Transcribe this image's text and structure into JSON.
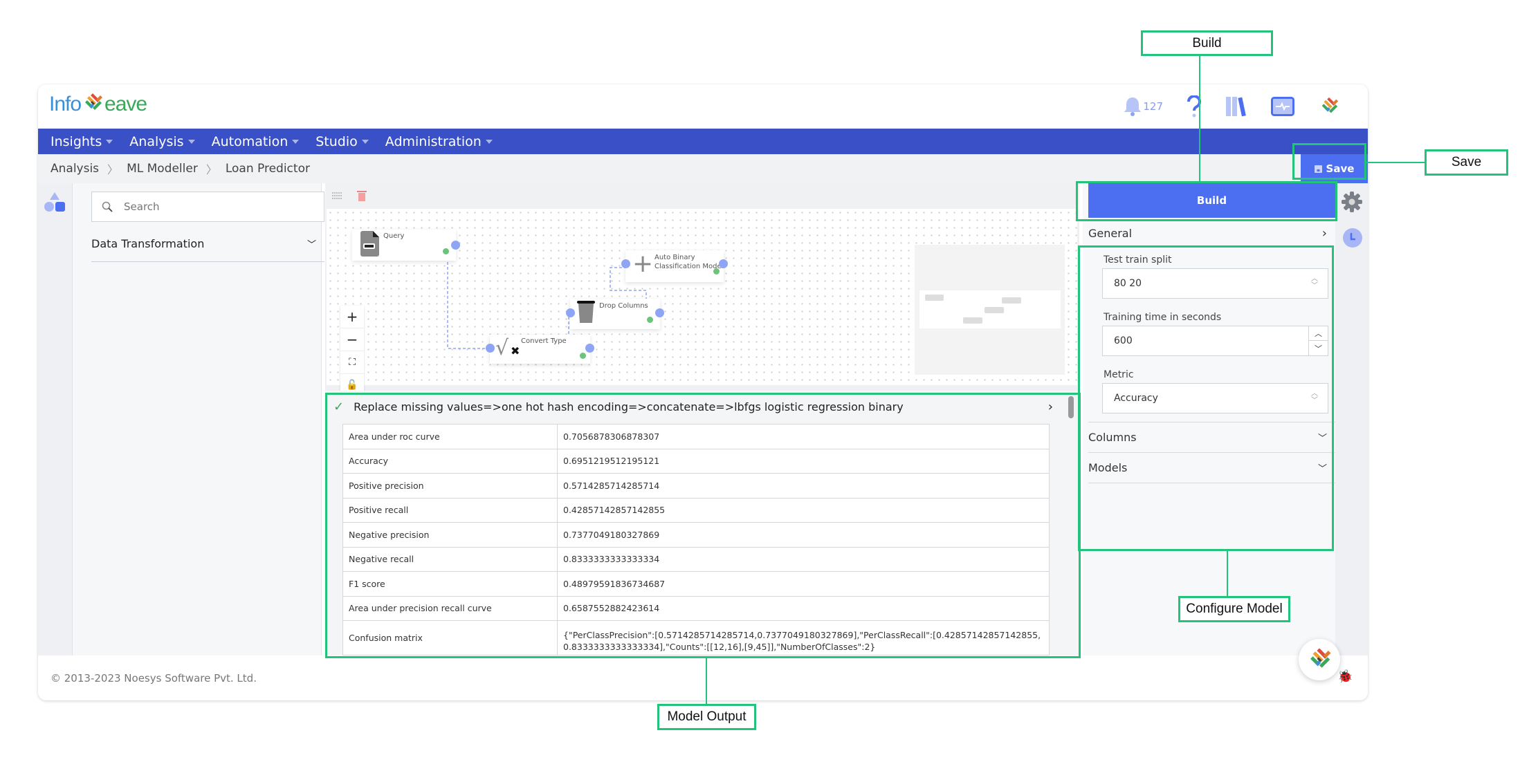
{
  "header": {
    "logo_left": "Info",
    "logo_right": "eave",
    "notification_count": "127",
    "icons": [
      "bell-icon",
      "help-icon",
      "library-icon",
      "monitor-icon",
      "brand-icon"
    ]
  },
  "nav": {
    "items": [
      {
        "label": "Insights"
      },
      {
        "label": "Analysis"
      },
      {
        "label": "Automation"
      },
      {
        "label": "Studio"
      },
      {
        "label": "Administration"
      }
    ]
  },
  "breadcrumb": [
    "Analysis",
    "ML Modeller",
    "Loan Predictor"
  ],
  "toolbar": {
    "save_label": "Save"
  },
  "sidebar": {
    "search_placeholder": "Search",
    "section": "Data Transformation"
  },
  "canvas": {
    "nodes": [
      {
        "label": "Query"
      },
      {
        "label": "Convert Type"
      },
      {
        "label": "Drop Columns"
      },
      {
        "label_line1": "Auto Binary",
        "label_line2": "Classification Model"
      }
    ]
  },
  "output": {
    "pipeline": "Replace missing values=>one hot hash encoding=>concatenate=>lbfgs logistic regression binary",
    "rows": [
      {
        "metric": "Area under roc curve",
        "value": "0.7056878306878307"
      },
      {
        "metric": "Accuracy",
        "value": "0.6951219512195121"
      },
      {
        "metric": "Positive precision",
        "value": "0.5714285714285714"
      },
      {
        "metric": "Positive recall",
        "value": "0.42857142857142855"
      },
      {
        "metric": "Negative precision",
        "value": "0.7377049180327869"
      },
      {
        "metric": "Negative recall",
        "value": "0.8333333333333334"
      },
      {
        "metric": "F1 score",
        "value": "0.48979591836734687"
      },
      {
        "metric": "Area under precision recall curve",
        "value": "0.6587552882423614"
      },
      {
        "metric": "Confusion matrix",
        "value": "{\"PerClassPrecision\":[0.5714285714285714,0.7377049180327869],\"PerClassRecall\":[0.42857142857142855,0.8333333333333334],\"Counts\":[[12,16],[9,45]],\"NumberOfClasses\":2}"
      }
    ]
  },
  "config": {
    "build_label": "Build",
    "general": "General",
    "test_train_split_label": "Test train split",
    "test_train_split_value": "80 20",
    "training_time_label": "Training time in seconds",
    "training_time_value": "600",
    "metric_label": "Metric",
    "metric_value": "Accuracy",
    "columns": "Columns",
    "models": "Models"
  },
  "footer": {
    "copyright": "© 2013-2023 Noesys Software Pvt. Ltd."
  },
  "annotations": {
    "build": "Build",
    "save": "Save",
    "configure_model": "Configure Model",
    "model_output": "Model Output"
  },
  "colors": {
    "primary": "#4c6ef0",
    "nav": "#3a50c7",
    "annotation": "#22c37a",
    "success": "#3aa85a"
  }
}
